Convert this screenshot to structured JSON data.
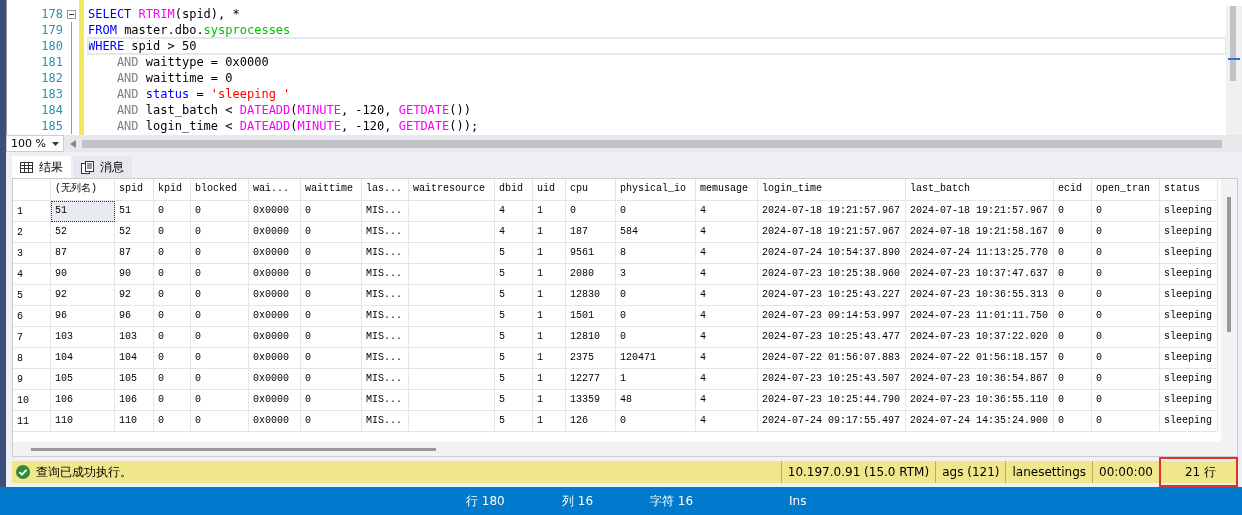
{
  "editor": {
    "lines": [
      {
        "number": "178",
        "collapsible": true,
        "current": false,
        "tokens": [
          {
            "text": "SELECT ",
            "kind": "keyword"
          },
          {
            "text": "RTRIM",
            "kind": "function"
          },
          {
            "text": "(spid), *",
            "kind": "plain"
          }
        ]
      },
      {
        "number": "179",
        "collapsible": false,
        "current": false,
        "tokens": [
          {
            "text": "FROM",
            "kind": "keyword"
          },
          {
            "text": " master.dbo.",
            "kind": "plain"
          },
          {
            "text": "sysprocesses",
            "kind": "system"
          }
        ]
      },
      {
        "number": "180",
        "collapsible": false,
        "current": true,
        "tokens": [
          {
            "text": "WHERE",
            "kind": "keyword"
          },
          {
            "text": " spid > 50",
            "kind": "plain"
          }
        ]
      },
      {
        "number": "181",
        "collapsible": false,
        "current": false,
        "tokens": [
          {
            "text": "    AND",
            "kind": "operator"
          },
          {
            "text": " waittype = 0x0000",
            "kind": "plain"
          }
        ]
      },
      {
        "number": "182",
        "collapsible": false,
        "current": false,
        "tokens": [
          {
            "text": "    AND",
            "kind": "operator"
          },
          {
            "text": " waittime = 0",
            "kind": "plain"
          }
        ]
      },
      {
        "number": "183",
        "collapsible": false,
        "current": false,
        "tokens": [
          {
            "text": "    AND ",
            "kind": "operator"
          },
          {
            "text": "status",
            "kind": "keyword"
          },
          {
            "text": " = ",
            "kind": "plain"
          },
          {
            "text": "'sleeping '",
            "kind": "string"
          }
        ]
      },
      {
        "number": "184",
        "collapsible": false,
        "current": false,
        "tokens": [
          {
            "text": "    AND",
            "kind": "operator"
          },
          {
            "text": " last_batch < ",
            "kind": "plain"
          },
          {
            "text": "DATEADD",
            "kind": "function"
          },
          {
            "text": "(",
            "kind": "plain"
          },
          {
            "text": "MINUTE",
            "kind": "function"
          },
          {
            "text": ", -120, ",
            "kind": "plain"
          },
          {
            "text": "GETDATE",
            "kind": "function"
          },
          {
            "text": "())",
            "kind": "plain"
          }
        ]
      },
      {
        "number": "185",
        "collapsible": false,
        "current": false,
        "tokens": [
          {
            "text": "    AND",
            "kind": "operator"
          },
          {
            "text": " login_time < ",
            "kind": "plain"
          },
          {
            "text": "DATEADD",
            "kind": "function"
          },
          {
            "text": "(",
            "kind": "plain"
          },
          {
            "text": "MINUTE",
            "kind": "function"
          },
          {
            "text": ", -120, ",
            "kind": "plain"
          },
          {
            "text": "GETDATE",
            "kind": "function"
          },
          {
            "text": "());",
            "kind": "plain"
          }
        ]
      }
    ]
  },
  "zoom": {
    "value": "100 %"
  },
  "tabs": [
    {
      "label": "结果",
      "kind": "grid",
      "selected": true
    },
    {
      "label": "消息",
      "kind": "messages",
      "selected": false
    }
  ],
  "table": {
    "columns": [
      "(无列名)",
      "spid",
      "kpid",
      "blocked",
      "wai...",
      "waittime",
      "las...",
      "waitresource",
      "dbid",
      "uid",
      "cpu",
      "physical_io",
      "memusage",
      "login_time",
      "last_batch",
      "ecid",
      "open_tran",
      "status"
    ],
    "rows": [
      {
        "number": "1",
        "focused": true,
        "cells": [
          "51",
          "51",
          "0",
          "0",
          "0x0000",
          "0",
          "MIS...",
          "",
          "4",
          "1",
          "0",
          "0",
          "4",
          "2024-07-18 19:21:57.967",
          "2024-07-18 19:21:57.967",
          "0",
          "0",
          "sleeping"
        ]
      },
      {
        "number": "2",
        "focused": false,
        "cells": [
          "52",
          "52",
          "0",
          "0",
          "0x0000",
          "0",
          "MIS...",
          "",
          "4",
          "1",
          "187",
          "584",
          "4",
          "2024-07-18 19:21:57.967",
          "2024-07-18 19:21:58.167",
          "0",
          "0",
          "sleeping"
        ]
      },
      {
        "number": "3",
        "focused": false,
        "cells": [
          "87",
          "87",
          "0",
          "0",
          "0x0000",
          "0",
          "MIS...",
          "",
          "5",
          "1",
          "9561",
          "8",
          "4",
          "2024-07-24 10:54:37.890",
          "2024-07-24 11:13:25.770",
          "0",
          "0",
          "sleeping"
        ]
      },
      {
        "number": "4",
        "focused": false,
        "cells": [
          "90",
          "90",
          "0",
          "0",
          "0x0000",
          "0",
          "MIS...",
          "",
          "5",
          "1",
          "2080",
          "3",
          "4",
          "2024-07-23 10:25:38.960",
          "2024-07-23 10:37:47.637",
          "0",
          "0",
          "sleeping"
        ]
      },
      {
        "number": "5",
        "focused": false,
        "cells": [
          "92",
          "92",
          "0",
          "0",
          "0x0000",
          "0",
          "MIS...",
          "",
          "5",
          "1",
          "12830",
          "0",
          "4",
          "2024-07-23 10:25:43.227",
          "2024-07-23 10:36:55.313",
          "0",
          "0",
          "sleeping"
        ]
      },
      {
        "number": "6",
        "focused": false,
        "cells": [
          "96",
          "96",
          "0",
          "0",
          "0x0000",
          "0",
          "MIS...",
          "",
          "5",
          "1",
          "1501",
          "0",
          "4",
          "2024-07-23 09:14:53.997",
          "2024-07-23 11:01:11.750",
          "0",
          "0",
          "sleeping"
        ]
      },
      {
        "number": "7",
        "focused": false,
        "cells": [
          "103",
          "103",
          "0",
          "0",
          "0x0000",
          "0",
          "MIS...",
          "",
          "5",
          "1",
          "12810",
          "0",
          "4",
          "2024-07-23 10:25:43.477",
          "2024-07-23 10:37:22.020",
          "0",
          "0",
          "sleeping"
        ]
      },
      {
        "number": "8",
        "focused": false,
        "cells": [
          "104",
          "104",
          "0",
          "0",
          "0x0000",
          "0",
          "MIS...",
          "",
          "5",
          "1",
          "2375",
          "120471",
          "4",
          "2024-07-22 01:56:07.883",
          "2024-07-22 01:56:18.157",
          "0",
          "0",
          "sleeping"
        ]
      },
      {
        "number": "9",
        "focused": false,
        "cells": [
          "105",
          "105",
          "0",
          "0",
          "0x0000",
          "0",
          "MIS...",
          "",
          "5",
          "1",
          "12277",
          "1",
          "4",
          "2024-07-23 10:25:43.507",
          "2024-07-23 10:36:54.867",
          "0",
          "0",
          "sleeping"
        ]
      },
      {
        "number": "10",
        "focused": false,
        "cells": [
          "106",
          "106",
          "0",
          "0",
          "0x0000",
          "0",
          "MIS...",
          "",
          "5",
          "1",
          "13359",
          "48",
          "4",
          "2024-07-23 10:25:44.790",
          "2024-07-23 10:36:55.110",
          "0",
          "0",
          "sleeping"
        ]
      },
      {
        "number": "11",
        "focused": false,
        "cells": [
          "110",
          "110",
          "0",
          "0",
          "0x0000",
          "0",
          "MIS...",
          "",
          "5",
          "1",
          "126",
          "0",
          "4",
          "2024-07-24 09:17:55.497",
          "2024-07-24 14:35:24.900",
          "0",
          "0",
          "sleeping"
        ]
      }
    ]
  },
  "query_status": {
    "message": "查询已成功执行。",
    "items": [
      {
        "text": "10.197.0.91 (15.0 RTM)",
        "highlighted": false
      },
      {
        "text": "ags (121)",
        "highlighted": false
      },
      {
        "text": "lanesettings",
        "highlighted": false
      },
      {
        "text": "00:00:00",
        "highlighted": false
      },
      {
        "text": "21 行",
        "highlighted": true
      }
    ]
  },
  "status_bar": {
    "items": [
      "行 180",
      "列 16",
      "字符 16",
      "Ins"
    ]
  }
}
